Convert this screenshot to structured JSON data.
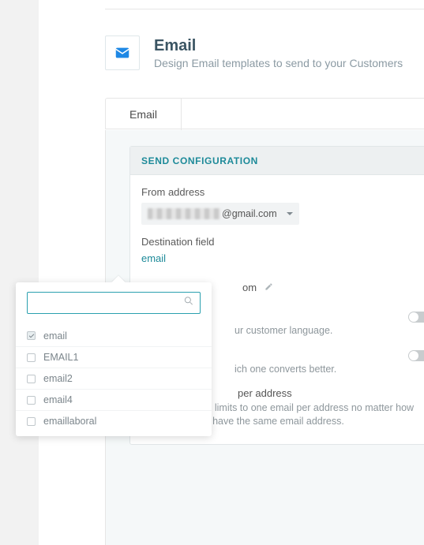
{
  "header": {
    "title": "Email",
    "subtitle": "Design Email templates to send to your Customers",
    "icon": "email-icon"
  },
  "tabs": [
    {
      "label": "Email"
    }
  ],
  "card": {
    "heading": "SEND CONFIGURATION",
    "from_label": "From address",
    "from_value_suffix": "@gmail.com",
    "destination_label": "Destination field",
    "destination_value": "email",
    "url_tracking_fragment": "om",
    "row_lang_sub": "ur customer language.",
    "row_ab_sub": "ich one converts better.",
    "row_unique_main_fragment": " per address",
    "row_unique_sub": "This options limits to one email per address no matter how many users have the same email address."
  },
  "popup": {
    "search_placeholder": "",
    "items": [
      {
        "label": "email",
        "checked": true
      },
      {
        "label": "EMAIL1",
        "checked": false
      },
      {
        "label": "email2",
        "checked": false
      },
      {
        "label": "email4",
        "checked": false
      },
      {
        "label": "emaillaboral",
        "checked": false
      }
    ]
  }
}
